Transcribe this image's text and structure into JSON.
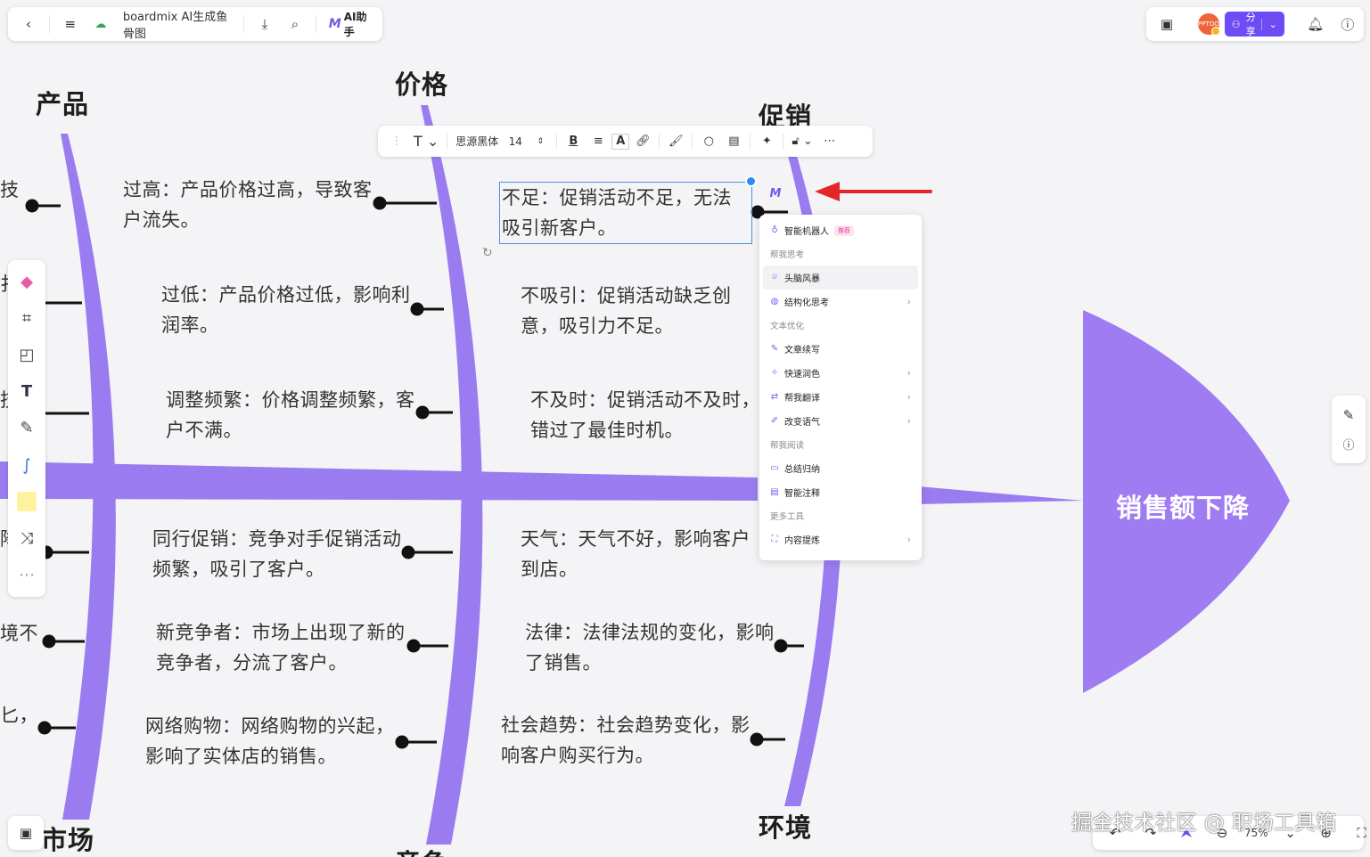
{
  "topbar": {
    "title": "boardmix AI生成鱼骨图",
    "ai_label": "AI助手",
    "ai_logo": "M",
    "share_label": "分享",
    "avatar_text": "PPTOO"
  },
  "format_bar": {
    "font": "思源黑体",
    "font_size": "14"
  },
  "categories": {
    "product": "产品",
    "price": "价格",
    "promotion": "促销",
    "market": "市场",
    "environment": "环境",
    "competition": "竞争"
  },
  "head": "销售额下降",
  "nodes": {
    "price_high": "过高：产品价格过高，导致客户流失。",
    "price_low": "过低：产品价格过低，影响利润率。",
    "price_freq": "调整频繁：价格调整频繁，客户不满。",
    "promo_lack": "不足：促销活动不足，无法吸引新客户。",
    "promo_unattractive": "不吸引：促销活动缺乏创意，吸引力不足。",
    "promo_late": "不及时：促销活动不及时，错过了最佳时机。",
    "comp_promo": "同行促销：竞争对手促销活动频繁，吸引了客户。",
    "comp_new": "新竞争者：市场上出现了新的竞争者，分流了客户。",
    "comp_online": "网络购物：网络购物的兴起，影响了实体店的销售。",
    "env_weather": "天气：天气不好，影响客户到店。",
    "env_law": "法律：法律法规的变化，影响了销售。",
    "env_social": "社会趋势：社会趋势变化，影响客户购买行为。",
    "left_frag_1": "技",
    "left_frag_2": "扌",
    "left_frag_3": "技",
    "left_frag_4": "降",
    "left_frag_5": "境不",
    "left_frag_6": "匕，"
  },
  "ai_menu": {
    "smart_bot": "智能机器人",
    "badge": "推荐",
    "group_think": "帮我思考",
    "brainstorm": "头脑风暴",
    "structured": "结构化思考",
    "group_text": "文本优化",
    "continue": "文章续写",
    "polish": "快速润色",
    "translate": "帮我翻译",
    "tone": "改变语气",
    "group_read": "帮我阅读",
    "summary": "总结归纳",
    "annotate": "智能注释",
    "group_more": "更多工具",
    "extract": "内容提炼"
  },
  "bottom": {
    "zoom": "75%"
  },
  "watermark": "掘金技术社区 @ 职场工具箱",
  "colors": {
    "bone": "#9b7cf0",
    "head": "#a07cf2",
    "accent": "#6e4cf5",
    "arrow": "#e5252a"
  }
}
